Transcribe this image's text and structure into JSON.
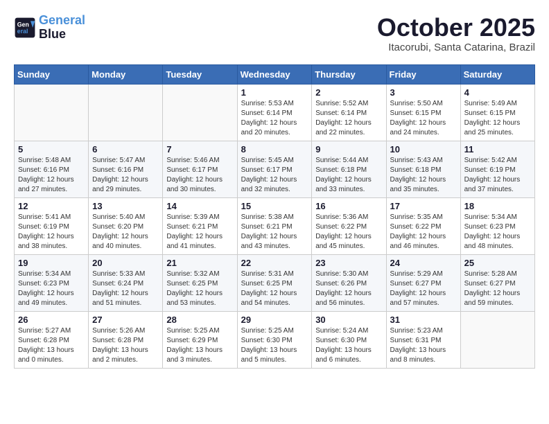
{
  "header": {
    "logo_line1": "General",
    "logo_line2": "Blue",
    "month": "October 2025",
    "location": "Itacorubi, Santa Catarina, Brazil"
  },
  "weekdays": [
    "Sunday",
    "Monday",
    "Tuesday",
    "Wednesday",
    "Thursday",
    "Friday",
    "Saturday"
  ],
  "weeks": [
    [
      {
        "day": "",
        "info": ""
      },
      {
        "day": "",
        "info": ""
      },
      {
        "day": "",
        "info": ""
      },
      {
        "day": "1",
        "info": "Sunrise: 5:53 AM\nSunset: 6:14 PM\nDaylight: 12 hours\nand 20 minutes."
      },
      {
        "day": "2",
        "info": "Sunrise: 5:52 AM\nSunset: 6:14 PM\nDaylight: 12 hours\nand 22 minutes."
      },
      {
        "day": "3",
        "info": "Sunrise: 5:50 AM\nSunset: 6:15 PM\nDaylight: 12 hours\nand 24 minutes."
      },
      {
        "day": "4",
        "info": "Sunrise: 5:49 AM\nSunset: 6:15 PM\nDaylight: 12 hours\nand 25 minutes."
      }
    ],
    [
      {
        "day": "5",
        "info": "Sunrise: 5:48 AM\nSunset: 6:16 PM\nDaylight: 12 hours\nand 27 minutes."
      },
      {
        "day": "6",
        "info": "Sunrise: 5:47 AM\nSunset: 6:16 PM\nDaylight: 12 hours\nand 29 minutes."
      },
      {
        "day": "7",
        "info": "Sunrise: 5:46 AM\nSunset: 6:17 PM\nDaylight: 12 hours\nand 30 minutes."
      },
      {
        "day": "8",
        "info": "Sunrise: 5:45 AM\nSunset: 6:17 PM\nDaylight: 12 hours\nand 32 minutes."
      },
      {
        "day": "9",
        "info": "Sunrise: 5:44 AM\nSunset: 6:18 PM\nDaylight: 12 hours\nand 33 minutes."
      },
      {
        "day": "10",
        "info": "Sunrise: 5:43 AM\nSunset: 6:18 PM\nDaylight: 12 hours\nand 35 minutes."
      },
      {
        "day": "11",
        "info": "Sunrise: 5:42 AM\nSunset: 6:19 PM\nDaylight: 12 hours\nand 37 minutes."
      }
    ],
    [
      {
        "day": "12",
        "info": "Sunrise: 5:41 AM\nSunset: 6:19 PM\nDaylight: 12 hours\nand 38 minutes."
      },
      {
        "day": "13",
        "info": "Sunrise: 5:40 AM\nSunset: 6:20 PM\nDaylight: 12 hours\nand 40 minutes."
      },
      {
        "day": "14",
        "info": "Sunrise: 5:39 AM\nSunset: 6:21 PM\nDaylight: 12 hours\nand 41 minutes."
      },
      {
        "day": "15",
        "info": "Sunrise: 5:38 AM\nSunset: 6:21 PM\nDaylight: 12 hours\nand 43 minutes."
      },
      {
        "day": "16",
        "info": "Sunrise: 5:36 AM\nSunset: 6:22 PM\nDaylight: 12 hours\nand 45 minutes."
      },
      {
        "day": "17",
        "info": "Sunrise: 5:35 AM\nSunset: 6:22 PM\nDaylight: 12 hours\nand 46 minutes."
      },
      {
        "day": "18",
        "info": "Sunrise: 5:34 AM\nSunset: 6:23 PM\nDaylight: 12 hours\nand 48 minutes."
      }
    ],
    [
      {
        "day": "19",
        "info": "Sunrise: 5:34 AM\nSunset: 6:23 PM\nDaylight: 12 hours\nand 49 minutes."
      },
      {
        "day": "20",
        "info": "Sunrise: 5:33 AM\nSunset: 6:24 PM\nDaylight: 12 hours\nand 51 minutes."
      },
      {
        "day": "21",
        "info": "Sunrise: 5:32 AM\nSunset: 6:25 PM\nDaylight: 12 hours\nand 53 minutes."
      },
      {
        "day": "22",
        "info": "Sunrise: 5:31 AM\nSunset: 6:25 PM\nDaylight: 12 hours\nand 54 minutes."
      },
      {
        "day": "23",
        "info": "Sunrise: 5:30 AM\nSunset: 6:26 PM\nDaylight: 12 hours\nand 56 minutes."
      },
      {
        "day": "24",
        "info": "Sunrise: 5:29 AM\nSunset: 6:27 PM\nDaylight: 12 hours\nand 57 minutes."
      },
      {
        "day": "25",
        "info": "Sunrise: 5:28 AM\nSunset: 6:27 PM\nDaylight: 12 hours\nand 59 minutes."
      }
    ],
    [
      {
        "day": "26",
        "info": "Sunrise: 5:27 AM\nSunset: 6:28 PM\nDaylight: 13 hours\nand 0 minutes."
      },
      {
        "day": "27",
        "info": "Sunrise: 5:26 AM\nSunset: 6:28 PM\nDaylight: 13 hours\nand 2 minutes."
      },
      {
        "day": "28",
        "info": "Sunrise: 5:25 AM\nSunset: 6:29 PM\nDaylight: 13 hours\nand 3 minutes."
      },
      {
        "day": "29",
        "info": "Sunrise: 5:25 AM\nSunset: 6:30 PM\nDaylight: 13 hours\nand 5 minutes."
      },
      {
        "day": "30",
        "info": "Sunrise: 5:24 AM\nSunset: 6:30 PM\nDaylight: 13 hours\nand 6 minutes."
      },
      {
        "day": "31",
        "info": "Sunrise: 5:23 AM\nSunset: 6:31 PM\nDaylight: 13 hours\nand 8 minutes."
      },
      {
        "day": "",
        "info": ""
      }
    ]
  ]
}
